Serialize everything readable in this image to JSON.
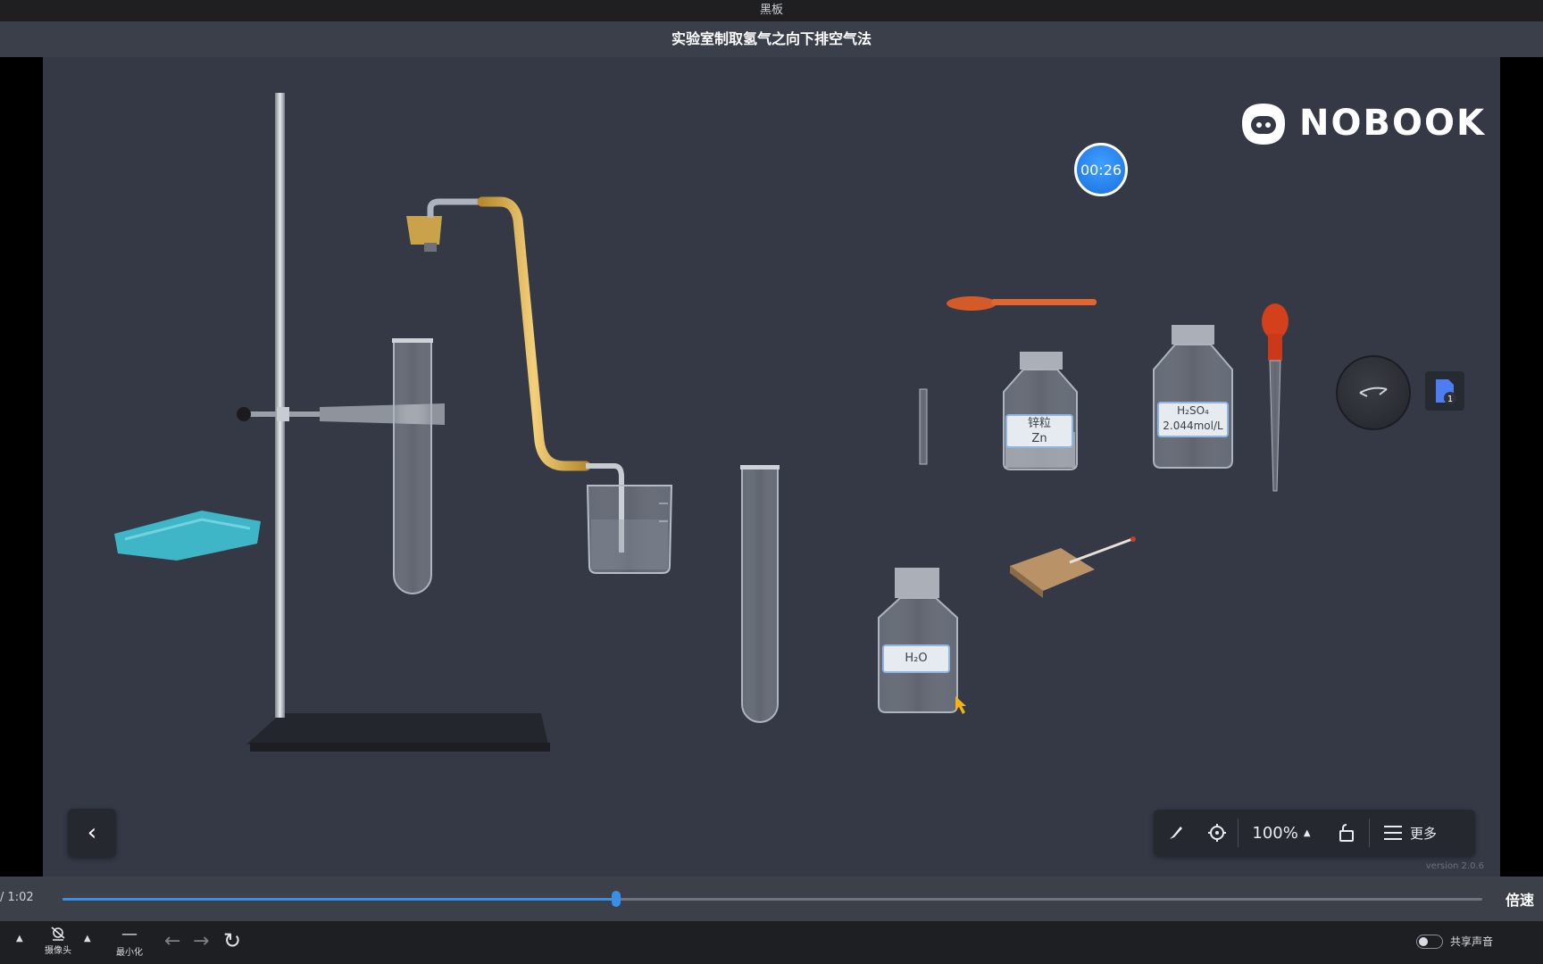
{
  "window": {
    "title": "黑板"
  },
  "header": {
    "title": "实验室制取氢气之向下排空气法"
  },
  "logo": {
    "brand": "NOBOOK"
  },
  "timer": {
    "value": "00:26"
  },
  "labels": {
    "zinc": {
      "name": "锌粒",
      "formula": "Zn"
    },
    "acid": {
      "formula": "H₂SO₄",
      "concentration": "2.044mol/L"
    },
    "water": {
      "formula": "H₂O"
    }
  },
  "doc_badge": {
    "count": "1"
  },
  "toolbar": {
    "zoom": "100%",
    "more_label": "更多"
  },
  "version": "version 2.0.6",
  "player": {
    "time_label": "/ 1:02",
    "progress": 0.39,
    "buffered": 0.27,
    "speed_label": "倍速"
  },
  "bottombar": {
    "camera_label": "摄像头",
    "minimize_label": "最小化",
    "share_audio_label": "共享声音"
  },
  "colors": {
    "accent": "#3a8ee6",
    "canvas": "#343945"
  }
}
